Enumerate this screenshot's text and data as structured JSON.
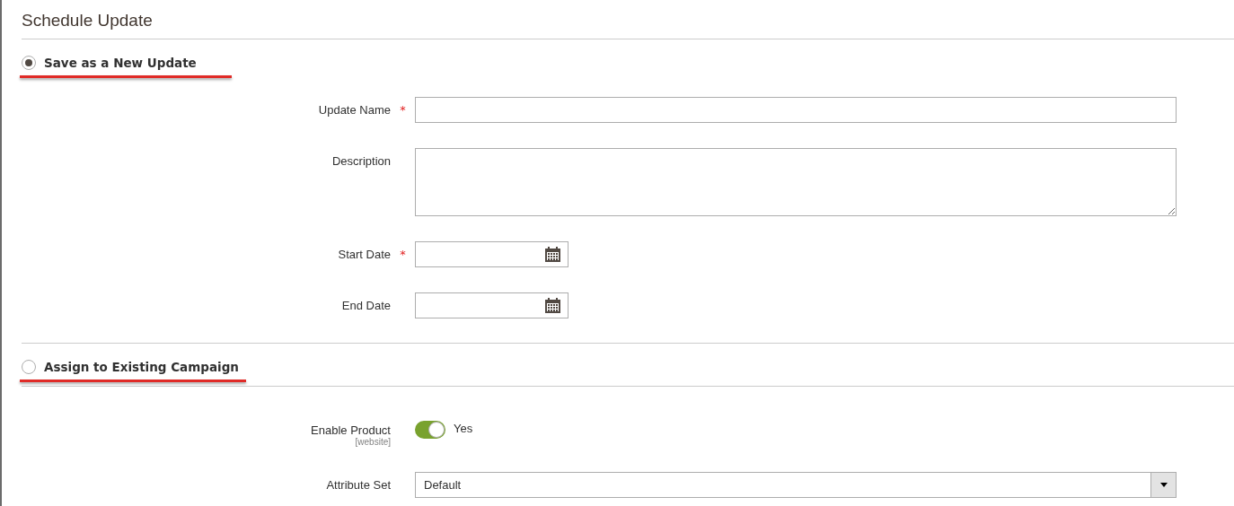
{
  "title": "Schedule Update",
  "sections": [
    {
      "label": "Save as a New Update",
      "selected": true,
      "fields": [
        {
          "kind": "text",
          "label": "Update Name",
          "required_mark": "*"
        },
        {
          "kind": "textarea",
          "label": "Description"
        },
        {
          "kind": "date",
          "label": "Start Date",
          "required_mark": "*"
        },
        {
          "kind": "date",
          "label": "End Date"
        }
      ]
    },
    {
      "label": "Assign to Existing Campaign",
      "selected": false,
      "fields": [
        {
          "kind": "toggle",
          "label": "Enable Product",
          "scope": "[website]",
          "on": true,
          "value": "Yes"
        },
        {
          "kind": "select",
          "label": "Attribute Set",
          "value": "Default"
        }
      ]
    }
  ]
}
